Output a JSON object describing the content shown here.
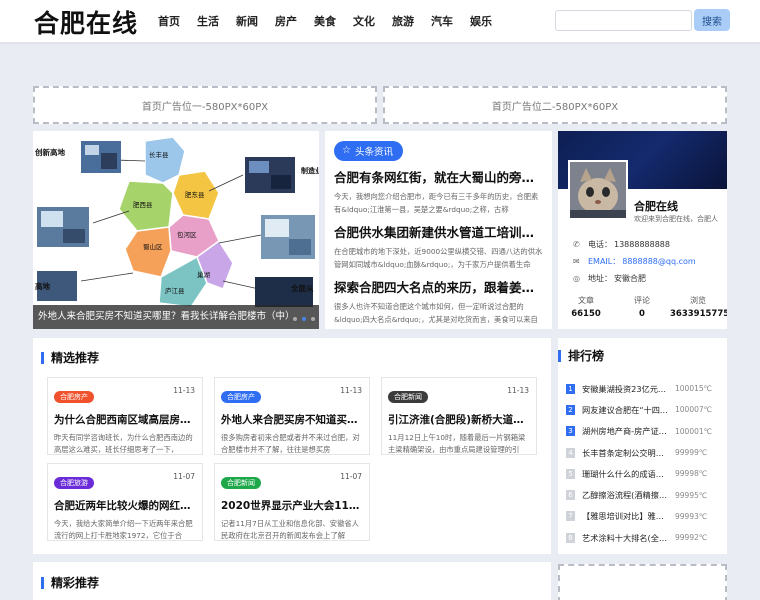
{
  "header": {
    "logo": "合肥在线",
    "nav": [
      "首页",
      "生活",
      "新闻",
      "房产",
      "美食",
      "文化",
      "旅游",
      "汽车",
      "娱乐"
    ],
    "search_placeholder": "",
    "search_button": "搜索"
  },
  "ads": {
    "ad1": "首页广告位一-580PX*60PX",
    "ad2": "首页广告位二-580PX*60PX"
  },
  "slider": {
    "caption": "外地人来合肥买房不知道买哪里？看我长详解合肥楼市（中）",
    "map_labels": [
      "创新高地",
      "长丰县",
      "制造业",
      "高地",
      "全面从",
      "肥西县",
      "肥东县",
      "巢湖",
      "庐江县",
      "蜀山区",
      "包河区"
    ],
    "dot_count": 3,
    "active_dot": 1
  },
  "headlines": {
    "badge": "头条资讯",
    "items": [
      {
        "title": "合肥有条网红街，就在大蜀山的旁边...",
        "desc": "今天，我想向您介绍合肥市，距今已有三千多年的历史，合肥素有&ldquo;江淮第一县，吴楚之要&rdquo;之称，古称"
      },
      {
        "title": "合肥供水集团新建供水管道工培训基...",
        "desc": "在合肥城市的地下深处，近9000公里纵横交错、四通八达的供水管网如同城市&ldquo;血脉&rdquo;，为千家万户提供着生命"
      },
      {
        "title": "探索合肥四大名点的来历，跟着姜潮...",
        "desc": "很多人也许不知道合肥这个城市如何，但一定听说过合肥的&ldquo;四大名点&rdquo;，尤其是对吃货而言，美食可以来自"
      }
    ]
  },
  "profile": {
    "name": "合肥在线",
    "welcome": "欢迎来到合肥在线，合肥人",
    "phone_label": "电话：",
    "phone": "13888888888",
    "email_label": "EMAIL：",
    "email": "8888888@qq.com",
    "address_label": "地址：",
    "address": "安徽合肥",
    "stats": [
      {
        "label": "文章",
        "value": "66150"
      },
      {
        "label": "评论",
        "value": "0"
      },
      {
        "label": "浏览",
        "value": "3633915775"
      }
    ]
  },
  "featured": {
    "title": "精选推荐",
    "cards": [
      {
        "tag": "合肥房产",
        "tag_color": "#f0522d",
        "date": "11-13",
        "title": "为什么合肥西南区域高层房源...",
        "desc": "昨天有同学咨询班长，为什么合肥西南边的高层这么难买，班长仔细思考了一下，"
      },
      {
        "tag": "合肥房产",
        "tag_color": "#2f6ef2",
        "date": "11-13",
        "title": "外地人来合肥买房不知道买哪...",
        "desc": "很多购房者初来合肥或者并不来过合肥，对合肥楼市并不了解，往往是想买房"
      },
      {
        "tag": "合肥新闻",
        "tag_color": "#3b3b3b",
        "date": "11-13",
        "title": "引江济淮(合肥段)新桥大道桥主...",
        "desc": "11月12日上午10时，随着最后一片钢箱梁主梁精确架设，由市重点局建设管理的引"
      },
      {
        "tag": "合肥旅游",
        "tag_color": "#6a2bd9",
        "date": "11-07",
        "title": "合肥近两年比较火爆的网红打...",
        "desc": "今天，我给大家简单介绍一下近两年来合肥流行的网上打卡胜地家1972，它位于合"
      },
      {
        "tag": "合肥新闻",
        "tag_color": "#1fa84a",
        "date": "11-07",
        "title": "2020世界显示产业大会11月20...",
        "desc": "记者11月7日从工业和信息化部、安徽省人民政府在北京召开的新闻发布会上了解"
      }
    ]
  },
  "ranking": {
    "title": "排行榜",
    "items": [
      {
        "num": "1",
        "color": "#2f6ef2",
        "name": "安徽巢湖投资23亿元推...",
        "views": "100015℃"
      },
      {
        "num": "2",
        "color": "#2f6ef2",
        "name": "网友建议合肥在“十四...",
        "views": "100007℃"
      },
      {
        "num": "3",
        "color": "#2f6ef2",
        "name": "湖州房地产商-房产证更...",
        "views": "100001℃"
      },
      {
        "num": "4",
        "color": "#cfd2d8",
        "name": "长丰首条定制公交明天开...",
        "views": "99999℃"
      },
      {
        "num": "5",
        "color": "#cfd2d8",
        "name": "珊瑚什么什么的成语有哪...",
        "views": "99998℃"
      },
      {
        "num": "6",
        "color": "#cfd2d8",
        "name": "乙醇擦浴流程(酒精擦浴...",
        "views": "99995℃"
      },
      {
        "num": "7",
        "color": "#cfd2d8",
        "name": "【雅思培训对比】雅思培...",
        "views": "99993℃"
      },
      {
        "num": "8",
        "color": "#cfd2d8",
        "name": "艺术涂料十大排名(全球...",
        "views": "99992℃"
      }
    ]
  },
  "more": {
    "title": "精彩推荐"
  }
}
